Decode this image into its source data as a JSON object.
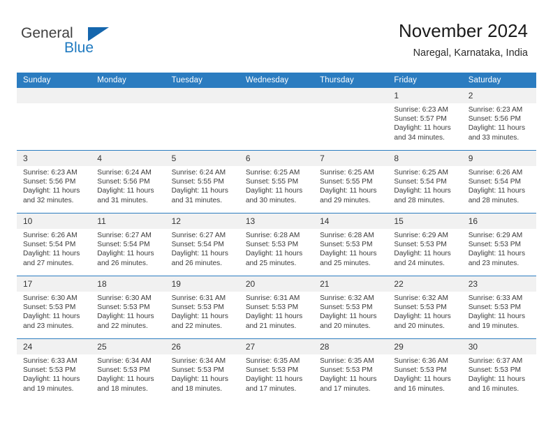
{
  "brand": {
    "name_part1": "General",
    "name_part2": "Blue",
    "accent_color": "#1f7ac0",
    "triangle_color": "#1566ad"
  },
  "header": {
    "month_title": "November 2024",
    "location": "Naregal, Karnataka, India"
  },
  "calendar": {
    "header_color": "#2b7cc0",
    "daynum_band_color": "#f1f1f1",
    "weekdays": [
      "Sunday",
      "Monday",
      "Tuesday",
      "Wednesday",
      "Thursday",
      "Friday",
      "Saturday"
    ],
    "weeks": [
      [
        {
          "empty": true
        },
        {
          "empty": true
        },
        {
          "empty": true
        },
        {
          "empty": true
        },
        {
          "empty": true
        },
        {
          "day": "1",
          "sunrise": "Sunrise: 6:23 AM",
          "sunset": "Sunset: 5:57 PM",
          "daylight": "Daylight: 11 hours and 34 minutes."
        },
        {
          "day": "2",
          "sunrise": "Sunrise: 6:23 AM",
          "sunset": "Sunset: 5:56 PM",
          "daylight": "Daylight: 11 hours and 33 minutes."
        }
      ],
      [
        {
          "day": "3",
          "sunrise": "Sunrise: 6:23 AM",
          "sunset": "Sunset: 5:56 PM",
          "daylight": "Daylight: 11 hours and 32 minutes."
        },
        {
          "day": "4",
          "sunrise": "Sunrise: 6:24 AM",
          "sunset": "Sunset: 5:56 PM",
          "daylight": "Daylight: 11 hours and 31 minutes."
        },
        {
          "day": "5",
          "sunrise": "Sunrise: 6:24 AM",
          "sunset": "Sunset: 5:55 PM",
          "daylight": "Daylight: 11 hours and 31 minutes."
        },
        {
          "day": "6",
          "sunrise": "Sunrise: 6:25 AM",
          "sunset": "Sunset: 5:55 PM",
          "daylight": "Daylight: 11 hours and 30 minutes."
        },
        {
          "day": "7",
          "sunrise": "Sunrise: 6:25 AM",
          "sunset": "Sunset: 5:55 PM",
          "daylight": "Daylight: 11 hours and 29 minutes."
        },
        {
          "day": "8",
          "sunrise": "Sunrise: 6:25 AM",
          "sunset": "Sunset: 5:54 PM",
          "daylight": "Daylight: 11 hours and 28 minutes."
        },
        {
          "day": "9",
          "sunrise": "Sunrise: 6:26 AM",
          "sunset": "Sunset: 5:54 PM",
          "daylight": "Daylight: 11 hours and 28 minutes."
        }
      ],
      [
        {
          "day": "10",
          "sunrise": "Sunrise: 6:26 AM",
          "sunset": "Sunset: 5:54 PM",
          "daylight": "Daylight: 11 hours and 27 minutes."
        },
        {
          "day": "11",
          "sunrise": "Sunrise: 6:27 AM",
          "sunset": "Sunset: 5:54 PM",
          "daylight": "Daylight: 11 hours and 26 minutes."
        },
        {
          "day": "12",
          "sunrise": "Sunrise: 6:27 AM",
          "sunset": "Sunset: 5:54 PM",
          "daylight": "Daylight: 11 hours and 26 minutes."
        },
        {
          "day": "13",
          "sunrise": "Sunrise: 6:28 AM",
          "sunset": "Sunset: 5:53 PM",
          "daylight": "Daylight: 11 hours and 25 minutes."
        },
        {
          "day": "14",
          "sunrise": "Sunrise: 6:28 AM",
          "sunset": "Sunset: 5:53 PM",
          "daylight": "Daylight: 11 hours and 25 minutes."
        },
        {
          "day": "15",
          "sunrise": "Sunrise: 6:29 AM",
          "sunset": "Sunset: 5:53 PM",
          "daylight": "Daylight: 11 hours and 24 minutes."
        },
        {
          "day": "16",
          "sunrise": "Sunrise: 6:29 AM",
          "sunset": "Sunset: 5:53 PM",
          "daylight": "Daylight: 11 hours and 23 minutes."
        }
      ],
      [
        {
          "day": "17",
          "sunrise": "Sunrise: 6:30 AM",
          "sunset": "Sunset: 5:53 PM",
          "daylight": "Daylight: 11 hours and 23 minutes."
        },
        {
          "day": "18",
          "sunrise": "Sunrise: 6:30 AM",
          "sunset": "Sunset: 5:53 PM",
          "daylight": "Daylight: 11 hours and 22 minutes."
        },
        {
          "day": "19",
          "sunrise": "Sunrise: 6:31 AM",
          "sunset": "Sunset: 5:53 PM",
          "daylight": "Daylight: 11 hours and 22 minutes."
        },
        {
          "day": "20",
          "sunrise": "Sunrise: 6:31 AM",
          "sunset": "Sunset: 5:53 PM",
          "daylight": "Daylight: 11 hours and 21 minutes."
        },
        {
          "day": "21",
          "sunrise": "Sunrise: 6:32 AM",
          "sunset": "Sunset: 5:53 PM",
          "daylight": "Daylight: 11 hours and 20 minutes."
        },
        {
          "day": "22",
          "sunrise": "Sunrise: 6:32 AM",
          "sunset": "Sunset: 5:53 PM",
          "daylight": "Daylight: 11 hours and 20 minutes."
        },
        {
          "day": "23",
          "sunrise": "Sunrise: 6:33 AM",
          "sunset": "Sunset: 5:53 PM",
          "daylight": "Daylight: 11 hours and 19 minutes."
        }
      ],
      [
        {
          "day": "24",
          "sunrise": "Sunrise: 6:33 AM",
          "sunset": "Sunset: 5:53 PM",
          "daylight": "Daylight: 11 hours and 19 minutes."
        },
        {
          "day": "25",
          "sunrise": "Sunrise: 6:34 AM",
          "sunset": "Sunset: 5:53 PM",
          "daylight": "Daylight: 11 hours and 18 minutes."
        },
        {
          "day": "26",
          "sunrise": "Sunrise: 6:34 AM",
          "sunset": "Sunset: 5:53 PM",
          "daylight": "Daylight: 11 hours and 18 minutes."
        },
        {
          "day": "27",
          "sunrise": "Sunrise: 6:35 AM",
          "sunset": "Sunset: 5:53 PM",
          "daylight": "Daylight: 11 hours and 17 minutes."
        },
        {
          "day": "28",
          "sunrise": "Sunrise: 6:35 AM",
          "sunset": "Sunset: 5:53 PM",
          "daylight": "Daylight: 11 hours and 17 minutes."
        },
        {
          "day": "29",
          "sunrise": "Sunrise: 6:36 AM",
          "sunset": "Sunset: 5:53 PM",
          "daylight": "Daylight: 11 hours and 16 minutes."
        },
        {
          "day": "30",
          "sunrise": "Sunrise: 6:37 AM",
          "sunset": "Sunset: 5:53 PM",
          "daylight": "Daylight: 11 hours and 16 minutes."
        }
      ]
    ]
  }
}
